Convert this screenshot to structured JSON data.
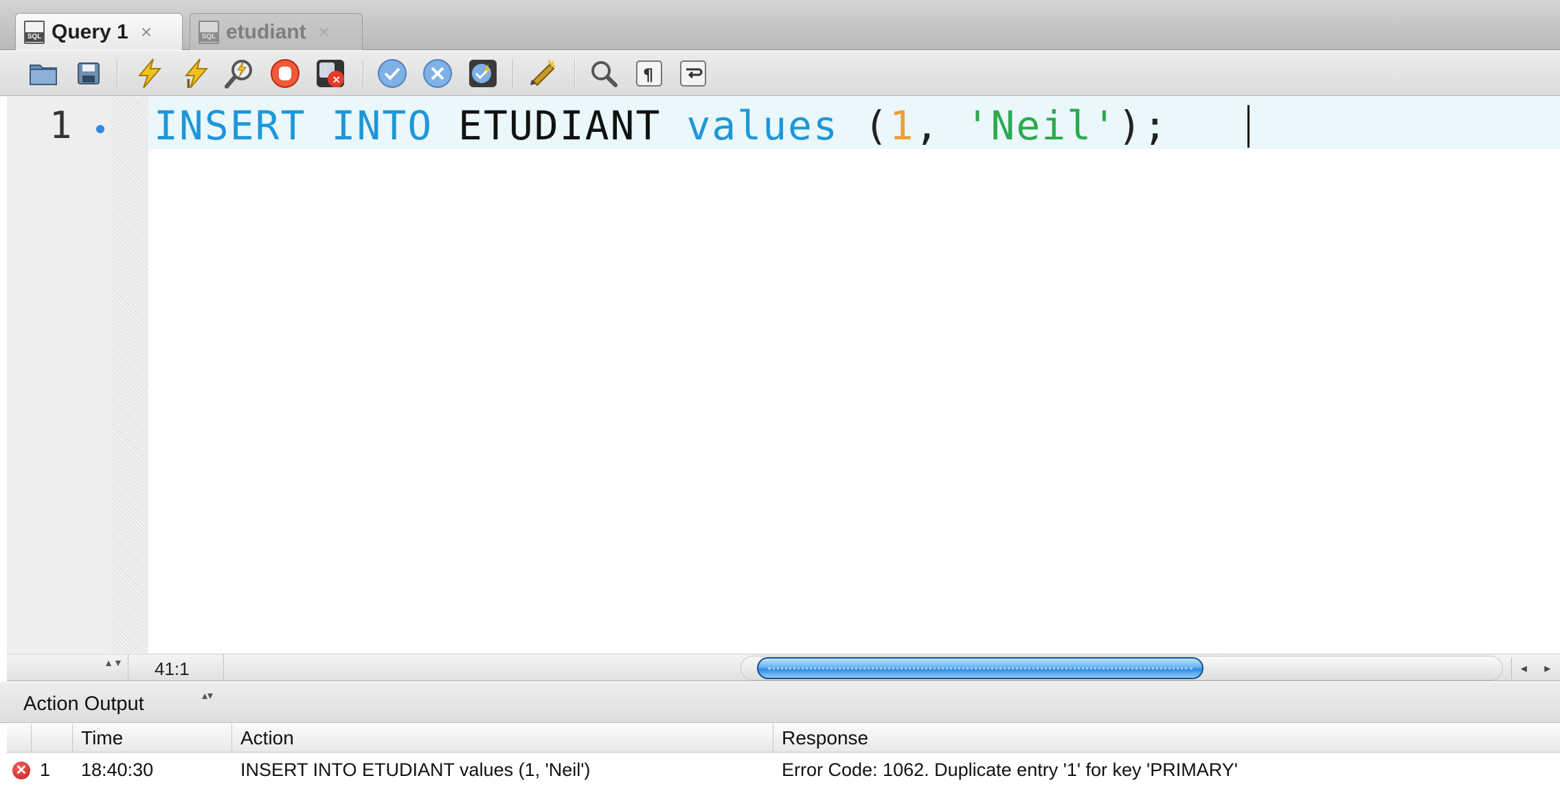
{
  "tabs": [
    {
      "label": "Query 1",
      "icon": "sql-file-icon",
      "icon_text": "SQL",
      "close": "×",
      "active": true
    },
    {
      "label": "etudiant",
      "icon": "sql-file-icon",
      "icon_text": "SQL",
      "close": "×",
      "active": false
    }
  ],
  "toolbar": {
    "icons": [
      "open-folder-icon",
      "save-icon",
      "execute-icon",
      "execute-current-icon",
      "explain-icon",
      "stop-icon",
      "stop-on-error-icon",
      "commit-icon",
      "rollback-icon",
      "autocommit-icon",
      "beautify-icon",
      "find-icon",
      "invisible-characters-icon",
      "word-wrap-icon"
    ]
  },
  "editor": {
    "line_number": "1",
    "code_tokens": [
      {
        "text": "INSERT",
        "kind": "keyword"
      },
      {
        "text": " ",
        "kind": "space"
      },
      {
        "text": "INTO",
        "kind": "keyword"
      },
      {
        "text": " ",
        "kind": "space"
      },
      {
        "text": "ETUDIANT",
        "kind": "identifier"
      },
      {
        "text": " ",
        "kind": "space"
      },
      {
        "text": "values",
        "kind": "keyword"
      },
      {
        "text": " ",
        "kind": "space"
      },
      {
        "text": "(",
        "kind": "punct"
      },
      {
        "text": "1",
        "kind": "number"
      },
      {
        "text": ", ",
        "kind": "punct"
      },
      {
        "text": "'Neil'",
        "kind": "string"
      },
      {
        "text": ");",
        "kind": "punct"
      }
    ],
    "colors": {
      "keyword": "#1e97d8",
      "number": "#e7a239",
      "string": "#2ba94e",
      "current_line": "#eaf7fb"
    }
  },
  "status": {
    "cursor_position": "41:1",
    "stepper": "▲▼",
    "scroll_left": "◂",
    "scroll_right": "▸"
  },
  "output": {
    "title": "Action Output",
    "selector_arrow": "▴▾",
    "columns": [
      "",
      "",
      "Time",
      "Action",
      "Response"
    ],
    "rows": [
      {
        "status_icon": "error-icon",
        "status_glyph": "✕",
        "number": "1",
        "time": "18:40:30",
        "action": "INSERT INTO ETUDIANT values (1, 'Neil')",
        "response": "Error Code: 1062. Duplicate entry '1' for key 'PRIMARY'"
      }
    ]
  }
}
